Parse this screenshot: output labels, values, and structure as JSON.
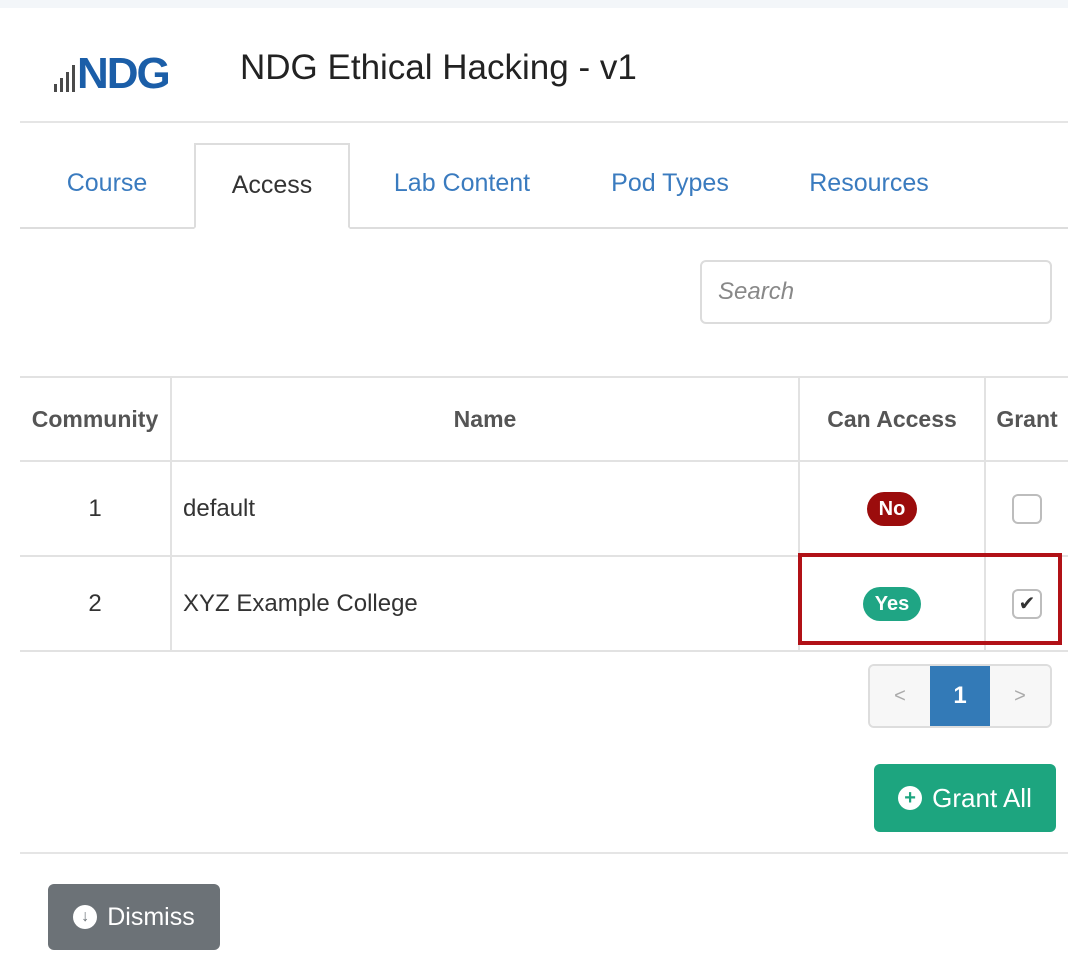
{
  "header": {
    "logo_text": "NDG",
    "title": "NDG Ethical Hacking - v1"
  },
  "tabs": [
    {
      "label": "Course",
      "active": false
    },
    {
      "label": "Access",
      "active": true
    },
    {
      "label": "Lab Content",
      "active": false
    },
    {
      "label": "Pod Types",
      "active": false
    },
    {
      "label": "Resources",
      "active": false
    }
  ],
  "search": {
    "placeholder": "Search",
    "value": ""
  },
  "table": {
    "headers": {
      "community": "Community",
      "name": "Name",
      "can_access": "Can Access",
      "grant": "Grant"
    },
    "rows": [
      {
        "community": "1",
        "name": "default",
        "can_access": "No",
        "granted": false
      },
      {
        "community": "2",
        "name": "XYZ Example College",
        "can_access": "Yes",
        "granted": true
      }
    ]
  },
  "pagination": {
    "prev": "<",
    "current": "1",
    "next": ">"
  },
  "buttons": {
    "grant_all": "Grant All",
    "dismiss": "Dismiss"
  },
  "colors": {
    "accent_blue": "#337ab7",
    "badge_no": "#9b0c0c",
    "badge_yes": "#1fa584",
    "highlight": "#b11117",
    "grant_green": "#1da57f",
    "dismiss_gray": "#6c7277"
  }
}
